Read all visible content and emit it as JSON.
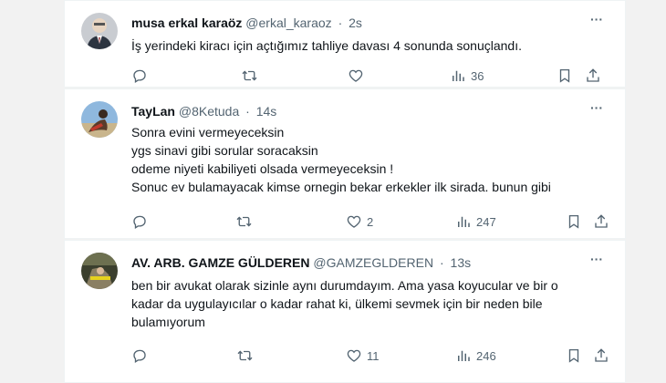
{
  "tweets": [
    {
      "name": "musa erkal karaöz",
      "handle": "@erkal_karaoz",
      "separator": "·",
      "time": "2s",
      "text": "İş yerindeki kiracı için açtığımız tahliye davası 4 sonunda sonuçlandı.",
      "likes": "",
      "views": "36",
      "more": "···"
    },
    {
      "name": "TayLan",
      "handle": "@8Ketuda",
      "separator": "·",
      "time": "14s",
      "text": "Sonra evini vermeyeceksin\nygs sinavi gibi sorular soracaksin\nodeme niyeti kabiliyeti olsada vermeyeceksin !\nSonuc ev bulamayacak kimse ornegin bekar erkekler ilk sirada. bunun gibi",
      "likes": "2",
      "views": "247",
      "more": "···"
    },
    {
      "name": "AV. ARB. GAMZE GÜLDEREN",
      "handle": "@GAMZEGLDEREN",
      "separator": "·",
      "time": "13s",
      "text": "ben bir avukat olarak sizinle aynı durumdayım. Ama yasa koyucular ve bir o\nkadar da uygulayıcılar o kadar rahat ki, ülkemi sevmek için bir neden bile\nbulamıyorum",
      "likes": "11",
      "views": "246",
      "more": "···"
    }
  ],
  "icons": {
    "reply": "reply-icon",
    "retweet": "retweet-icon",
    "like": "like-icon",
    "views": "views-icon",
    "bookmark": "bookmark-icon",
    "share": "share-icon"
  },
  "colors": {
    "text": "#0f1419",
    "secondary": "#536471",
    "background": "#f2f2f2",
    "card": "#ffffff"
  }
}
